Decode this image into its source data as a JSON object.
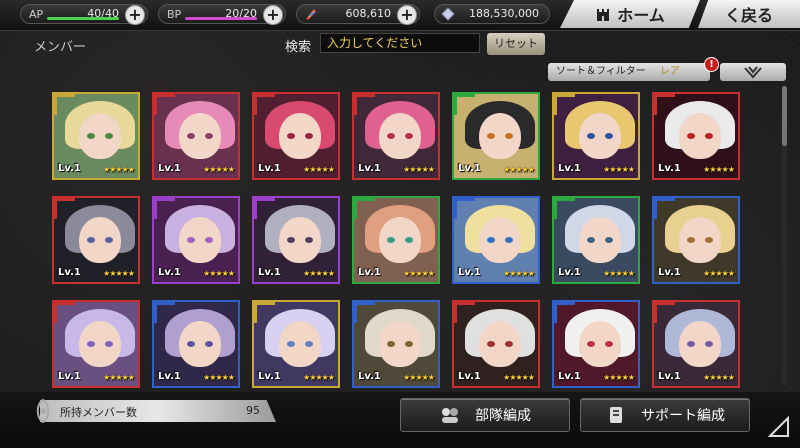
{
  "status": {
    "ap": {
      "label": "AP",
      "value": "40/40",
      "fill": 1.0,
      "color": "#4bd04b"
    },
    "bp": {
      "label": "BP",
      "value": "20/20",
      "fill": 1.0,
      "color": "#d04bd0"
    },
    "gems": {
      "value": "608,610",
      "icon": "rainbow-gem-icon"
    },
    "crystals": {
      "value": "188,530,000",
      "icon": "crystal-icon"
    }
  },
  "nav": {
    "home_label": "ホーム",
    "back_label": "く戻る"
  },
  "header": {
    "section_title": "メンバー",
    "search_label": "検索",
    "search_placeholder": "入力してください",
    "reset_label": "リセット",
    "sort_label": "ソート＆フィルター",
    "sort_value": "レア",
    "alert": "!"
  },
  "characters": [
    {
      "lv": "Lv.1",
      "stars": "★★★★★",
      "frame": "#c8a838",
      "hair": "#e8d89a",
      "bg": "#6a8a60",
      "eye": "#4a8a40"
    },
    {
      "lv": "Lv.1",
      "stars": "★★★★★",
      "frame": "#c83030",
      "hair": "#e88ab8",
      "bg": "#6a3050",
      "eye": "#8a4060"
    },
    {
      "lv": "Lv.1",
      "stars": "★★★★★",
      "frame": "#c83030",
      "hair": "#d84a70",
      "bg": "#502030",
      "eye": "#a02040"
    },
    {
      "lv": "Lv.1",
      "stars": "★★★★★",
      "frame": "#c83030",
      "hair": "#e06090",
      "bg": "#402838",
      "eye": "#b03050"
    },
    {
      "lv": "Lv.1",
      "stars": "★★★★★",
      "frame": "#30a840",
      "hair": "#2a2a2a",
      "bg": "#c8b070",
      "eye": "#c87020"
    },
    {
      "lv": "Lv.1",
      "stars": "★★★★★",
      "frame": "#c8a838",
      "hair": "#e8c870",
      "bg": "#402040",
      "eye": "#3050a0"
    },
    {
      "lv": "Lv.1",
      "stars": "★★★★★",
      "frame": "#c83030",
      "hair": "#eaeaea",
      "bg": "#301018",
      "eye": "#c02020"
    },
    {
      "lv": "Lv.1",
      "stars": "★★★★★",
      "frame": "#c83030",
      "hair": "#8a8a9a",
      "bg": "#202028",
      "eye": "#5060a0"
    },
    {
      "lv": "Lv.1",
      "stars": "★★★★★",
      "frame": "#9a40c8",
      "hair": "#c8b0e0",
      "bg": "#4a2050",
      "eye": "#a060c0"
    },
    {
      "lv": "Lv.1",
      "stars": "★★★★★",
      "frame": "#9a40c8",
      "hair": "#b0b0c0",
      "bg": "#302038",
      "eye": "#504060"
    },
    {
      "lv": "Lv.1",
      "stars": "★★★★★",
      "frame": "#30a840",
      "hair": "#e0a080",
      "bg": "#806050",
      "eye": "#30a080"
    },
    {
      "lv": "Lv.1",
      "stars": "★★★★★",
      "frame": "#3060c8",
      "hair": "#f0e0a0",
      "bg": "#6080b0",
      "eye": "#3070c0"
    },
    {
      "lv": "Lv.1",
      "stars": "★★★★★",
      "frame": "#30a840",
      "hair": "#d0d8e8",
      "bg": "#3a4a60",
      "eye": "#406080"
    },
    {
      "lv": "Lv.1",
      "stars": "★★★★★",
      "frame": "#3060c8",
      "hair": "#e8d090",
      "bg": "#403828",
      "eye": "#a07030"
    },
    {
      "lv": "Lv.1",
      "stars": "★★★★★",
      "frame": "#c83030",
      "hair": "#c8b8e8",
      "bg": "#6a5080",
      "eye": "#8060c0"
    },
    {
      "lv": "Lv.1",
      "stars": "★★★★★",
      "frame": "#3060c8",
      "hair": "#b0a0d0",
      "bg": "#302848",
      "eye": "#6050a0"
    },
    {
      "lv": "Lv.1",
      "stars": "★★★★★",
      "frame": "#c8a838",
      "hair": "#d8d0f0",
      "bg": "#403860",
      "eye": "#6080c0"
    },
    {
      "lv": "Lv.1",
      "stars": "★★★★★",
      "frame": "#3060c8",
      "hair": "#e0d8c8",
      "bg": "#504838",
      "eye": "#806030"
    },
    {
      "lv": "Lv.1",
      "stars": "★★★★★",
      "frame": "#c83030",
      "hair": "#e0e0e0",
      "bg": "#302020",
      "eye": "#a03030"
    },
    {
      "lv": "Lv.1",
      "stars": "★★★★★",
      "frame": "#3060c8",
      "hair": "#f0f0f0",
      "bg": "#501828",
      "eye": "#c03040"
    },
    {
      "lv": "Lv.1",
      "stars": "★★★★★",
      "frame": "#c83030",
      "hair": "#b0b8d8",
      "bg": "#382838",
      "eye": "#7060a0"
    }
  ],
  "footer": {
    "owned_label": "所持メンバー数",
    "owned_count": "95",
    "party_label": "部隊編成",
    "support_label": "サポート編成"
  }
}
